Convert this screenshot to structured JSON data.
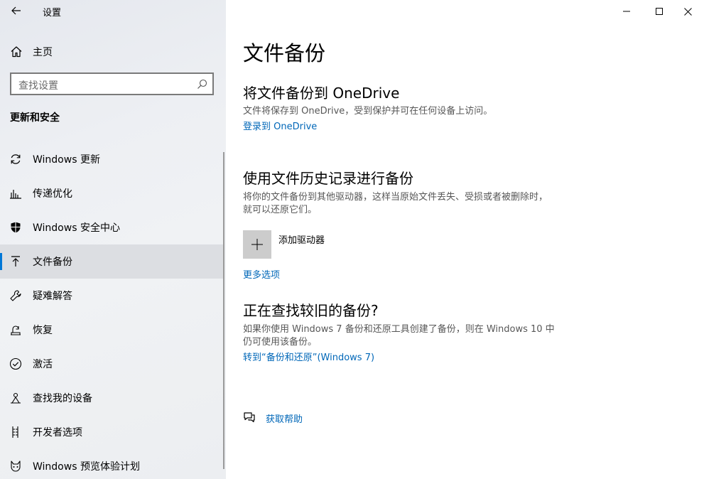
{
  "window": {
    "title": "设置",
    "controls": {
      "minimize": "minimize-icon",
      "maximize": "maximize-icon",
      "close": "close-icon"
    }
  },
  "sidebar": {
    "home_label": "主页",
    "search_placeholder": "查找设置",
    "section_title": "更新和安全",
    "items": [
      {
        "label": "Windows 更新",
        "icon": "sync-icon",
        "selected": false
      },
      {
        "label": "传递优化",
        "icon": "delivery-optimization-icon",
        "selected": false
      },
      {
        "label": "Windows 安全中心",
        "icon": "shield-icon",
        "selected": false
      },
      {
        "label": "文件备份",
        "icon": "backup-icon",
        "selected": true
      },
      {
        "label": "疑难解答",
        "icon": "wrench-icon",
        "selected": false
      },
      {
        "label": "恢复",
        "icon": "recovery-icon",
        "selected": false
      },
      {
        "label": "激活",
        "icon": "check-circle-icon",
        "selected": false
      },
      {
        "label": "查找我的设备",
        "icon": "find-device-icon",
        "selected": false
      },
      {
        "label": "开发者选项",
        "icon": "developer-icon",
        "selected": false
      },
      {
        "label": "Windows 预览体验计划",
        "icon": "insider-icon",
        "selected": false
      }
    ]
  },
  "main": {
    "title": "文件备份",
    "onedrive": {
      "heading": "将文件备份到 OneDrive",
      "description": "文件将保存到 OneDrive，受到保护并可在任何设备上访问。",
      "link": "登录到 OneDrive"
    },
    "file_history": {
      "heading": "使用文件历史记录进行备份",
      "description": "将你的文件备份到其他驱动器，这样当原始文件丢失、受损或者被删除时，就可以还原它们。",
      "add_drive_label": "添加驱动器",
      "more_options": "更多选项"
    },
    "older_backup": {
      "heading": "正在查找较旧的备份?",
      "description": "如果你使用 Windows 7 备份和还原工具创建了备份，则在 Windows 10 中仍可使用该备份。",
      "link": "转到“备份和还原”(Windows 7)"
    },
    "help": {
      "label": "获取帮助",
      "icon": "help-chat-icon"
    }
  },
  "colors": {
    "accent": "#0078d7",
    "link": "#0067b8",
    "sidebar_bg": "#edeff3",
    "selected_bg": "#dcdee2"
  }
}
